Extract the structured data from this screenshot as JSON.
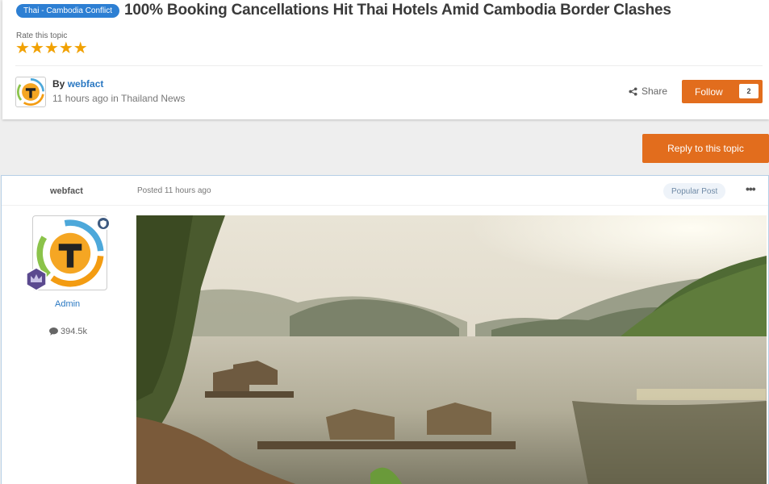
{
  "topic": {
    "tag": "Thai - Cambodia Conflict",
    "title": "100% Booking Cancellations Hit Thai Hotels Amid Cambodia Border Clashes",
    "rate_label": "Rate this topic",
    "rating": 5,
    "by_prefix": "By",
    "author": "webfact",
    "time_ago": "11 hours ago",
    "in_word": "in",
    "forum": "Thailand News"
  },
  "actions": {
    "share_label": "Share",
    "follow_label": "Follow",
    "follow_count": "2",
    "reply_label": "Reply to this topic"
  },
  "post": {
    "author": "webfact",
    "posted_label": "Posted 11 hours ago",
    "badge": "Popular Post",
    "more_icon": "ellipsis-icon",
    "rank": "Admin",
    "post_count": "394.5k"
  },
  "colors": {
    "accent": "#e26d1d",
    "link": "#2a78c2",
    "tag": "#2d7fd3",
    "star": "#f1a102"
  }
}
